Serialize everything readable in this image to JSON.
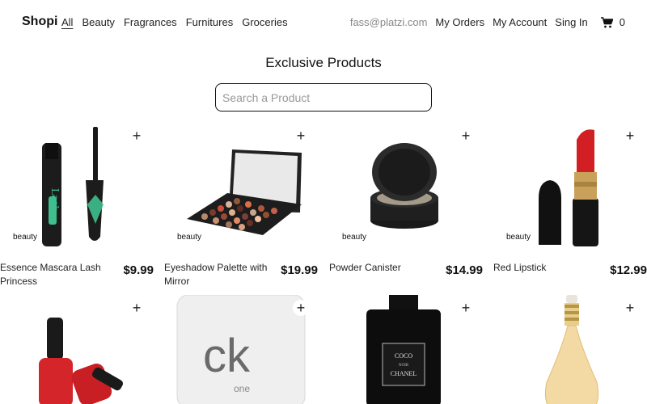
{
  "nav": {
    "brand": "Shopi",
    "categories": [
      "All",
      "Beauty",
      "Fragrances",
      "Furnitures",
      "Groceries"
    ],
    "email": "fass@platzi.com",
    "my_orders": "My Orders",
    "my_account": "My Account",
    "sign_in": "Sing In",
    "cart_count": "0"
  },
  "page": {
    "title": "Exclusive Products",
    "search_placeholder": "Search a Product"
  },
  "products": [
    {
      "title": "Essence Mascara Lash Princess",
      "price": "$9.99",
      "category": "beauty"
    },
    {
      "title": "Eyeshadow Palette with Mirror",
      "price": "$19.99",
      "category": "beauty"
    },
    {
      "title": "Powder Canister",
      "price": "$14.99",
      "category": "beauty"
    },
    {
      "title": "Red Lipstick",
      "price": "$12.99",
      "category": "beauty"
    }
  ],
  "add_icon": "+"
}
